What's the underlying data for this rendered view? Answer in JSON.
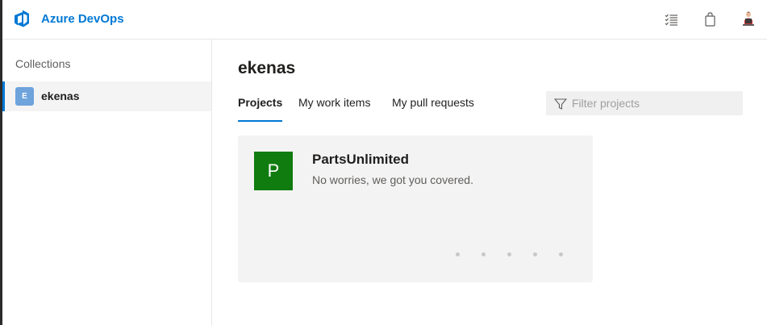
{
  "header": {
    "app_title": "Azure DevOps",
    "icons": [
      "logo-icon",
      "notifications-list-icon",
      "marketplace-bag-icon",
      "user-avatar-icon"
    ]
  },
  "sidebar": {
    "section_label": "Collections",
    "items": [
      {
        "initial": "E",
        "label": "ekenas",
        "selected": true
      }
    ]
  },
  "main": {
    "org_title": "ekenas",
    "tabs": [
      {
        "label": "Projects",
        "active": true
      },
      {
        "label": "My work items",
        "active": false
      },
      {
        "label": "My pull requests",
        "active": false
      }
    ],
    "filter": {
      "placeholder": "Filter projects",
      "value": ""
    },
    "projects": [
      {
        "initial": "P",
        "name": "PartsUnlimited",
        "description": "No worries, we got you covered."
      }
    ]
  },
  "colors": {
    "accent": "#0078d4",
    "project_avatar": "#107c10",
    "collection_badge": "#6ea3dc"
  }
}
